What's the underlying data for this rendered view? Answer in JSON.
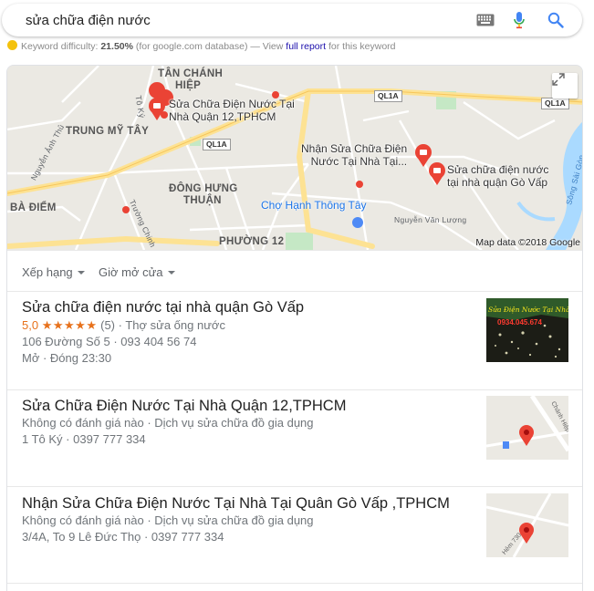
{
  "search": {
    "query": "sửa chữa điện nước"
  },
  "icons": {
    "keyboard": "keyboard-icon",
    "mic": "microphone-icon",
    "search": "search-icon",
    "expand": "expand-icon",
    "pin": "map-pin-icon",
    "star": "star-icon"
  },
  "keyword_bar": {
    "prefix": "Keyword difficulty: ",
    "value": "21.50%",
    "middle": " (for google.com database) — View ",
    "link": "full report",
    "suffix": " for this keyword"
  },
  "map": {
    "areas": [
      "TÂN CHÁNH HIỆP",
      "TRUNG MỸ TÂY",
      "ĐÔNG HƯNG THUẬN",
      "BÀ ĐIỂM",
      "PHƯỜNG 12"
    ],
    "area_thuan_line1": "ĐÔNG HƯNG",
    "area_thuan_line2": "THUẬN",
    "area_chanh_line1": "TÂN CHÁNH",
    "area_chanh_line2": "HIỆP",
    "roads": [
      "QL1A",
      "QL1A",
      "QL1A"
    ],
    "street_labels": [
      "Tô Ký",
      "Nguyễn Ảnh Thủ",
      "Trường Chinh",
      "Nguyễn Văn Lượng",
      "Sông Sài Gòn"
    ],
    "poi": "Chợ Hạnh Thông Tây",
    "business_pins": [
      {
        "line1": "Sửa Chữa Điện Nước Tại",
        "line2": "Nhà Quận 12,TPHCM"
      },
      {
        "line1": "Nhận Sửa Chữa Điện",
        "line2": "Nước Tại Nhà Tại..."
      },
      {
        "line1": "Sửa chữa điện nước",
        "line2": "tại nhà quận Gò Vấp"
      }
    ],
    "credit": "Map data ©2018 Google"
  },
  "filters": {
    "rating": "Xếp hạng",
    "hours": "Giờ mở cửa"
  },
  "results": [
    {
      "title": "Sửa chữa điện nước tại nhà quận Gò Vấp",
      "rating": "5,0",
      "stars": "★★★★★",
      "reviews": "(5)",
      "category": "Thợ sửa ống nước",
      "address": "106 Đường Số 5 · 093 404 56 74",
      "hours": "Mở · Đóng 23:30",
      "thumb_text_1": "Sửa Điện Nước Tại Nhà",
      "thumb_text_2": "0934.045.674"
    },
    {
      "title": "Sửa Chữa Điện Nước Tại Nhà Quận 12,TPHCM",
      "meta": "Không có đánh giá nào · Dịch vụ sửa chữa đồ gia dụng",
      "address": "1 Tô Ký · 0397 777 334",
      "thumb_street": "Chánh Hiệp 36"
    },
    {
      "title": "Nhận Sửa Chữa Điện Nước Tại Nhà Tại Quân Gò Vấp ,TPHCM",
      "meta": "Không có đánh giá nào · Dịch vụ sửa chữa đồ gia dụng",
      "address": "3/4A, To 9 Lê Đức Thọ · 0397 777 334",
      "thumb_street": "Hẻm 730"
    }
  ],
  "colors": {
    "accent_blue": "#4285f4",
    "pin_red": "#ea4335",
    "star_orange": "#e7711b",
    "highway_yellow": "#fde293"
  }
}
